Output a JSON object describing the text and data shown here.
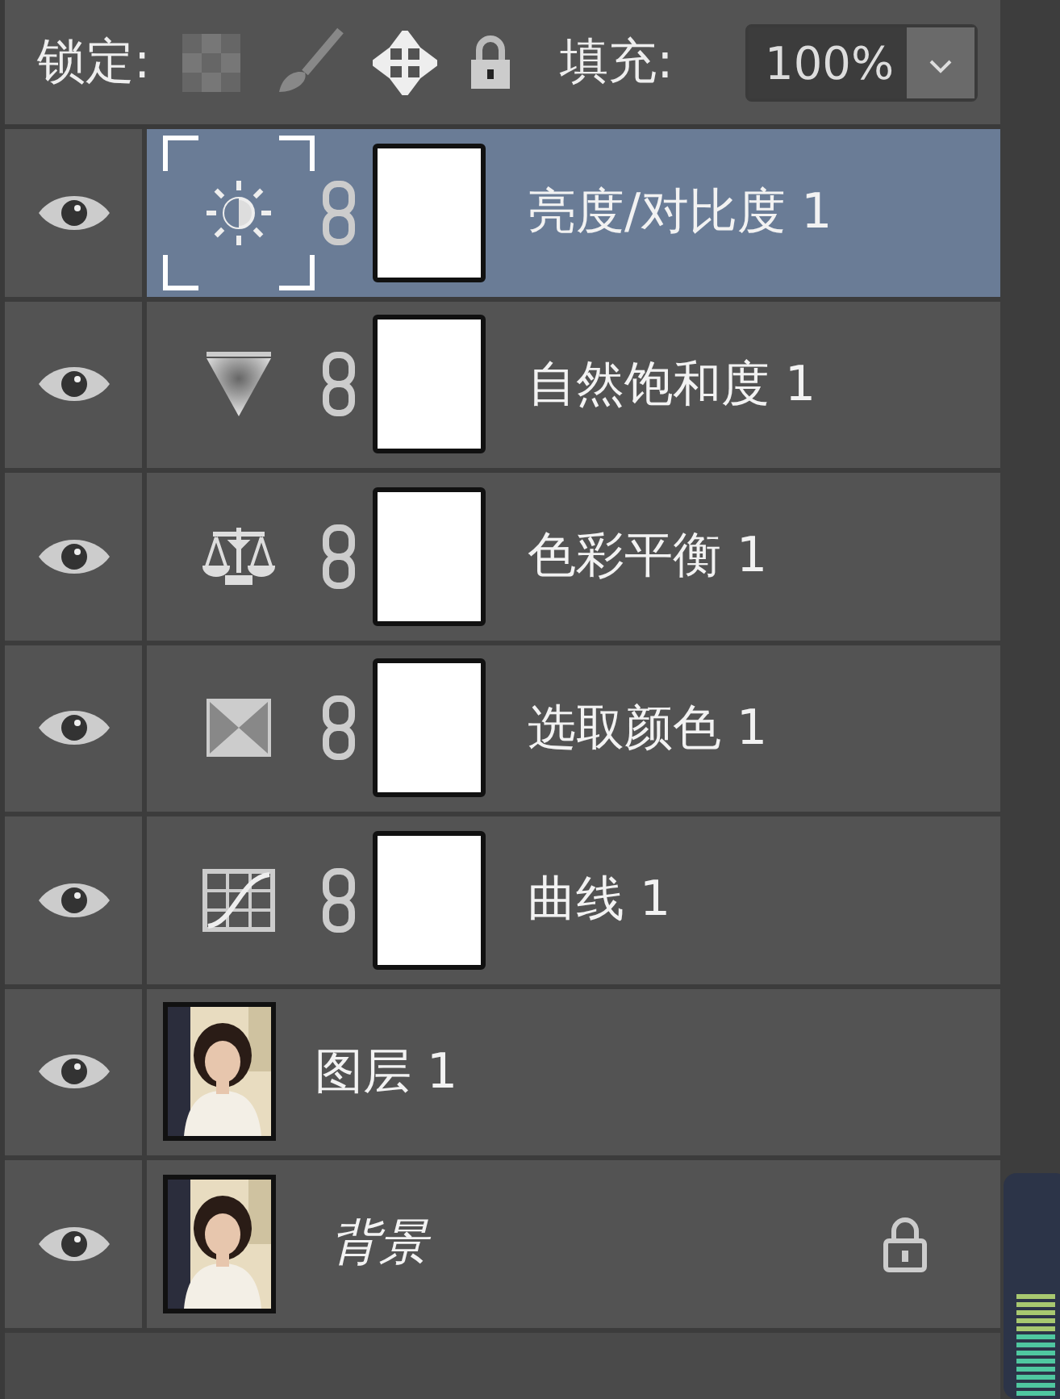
{
  "lock_bar": {
    "label": "锁定:",
    "fill_label": "填充:",
    "fill_value": "100%"
  },
  "layers": [
    {
      "kind": "brightness",
      "name": "亮度/对比度 1",
      "visible": true,
      "selected": true
    },
    {
      "kind": "vibrance",
      "name": "自然饱和度 1",
      "visible": true,
      "selected": false
    },
    {
      "kind": "balance",
      "name": "色彩平衡 1",
      "visible": true,
      "selected": false
    },
    {
      "kind": "selective",
      "name": "选取颜色 1",
      "visible": true,
      "selected": false
    },
    {
      "kind": "curves",
      "name": "曲线 1",
      "visible": true,
      "selected": false
    },
    {
      "kind": "pixel",
      "name": "图层 1",
      "visible": true,
      "selected": false
    },
    {
      "kind": "background",
      "name": "背景",
      "visible": true,
      "selected": false,
      "locked": true
    }
  ]
}
